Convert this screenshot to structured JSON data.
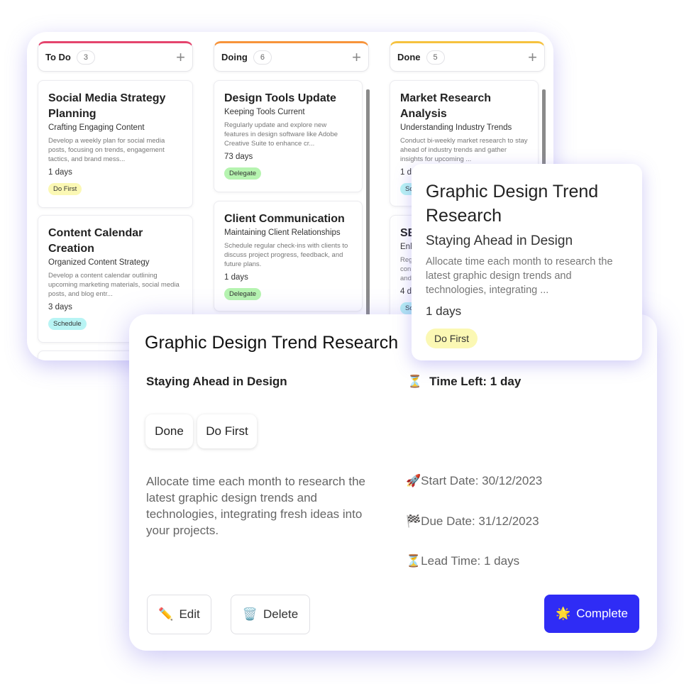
{
  "columns": [
    {
      "name": "To Do",
      "count": "3",
      "color": "#e5446d",
      "cards": [
        {
          "title": "Social Media Strategy Planning",
          "subtitle": "Crafting Engaging Content",
          "description": "Develop a weekly plan for social media posts, focusing on trends, engagement tactics, and brand mess...",
          "days": "1 days",
          "tag": "Do First",
          "tag_color": "#fbf8b4"
        },
        {
          "title": "Content Calendar Creation",
          "subtitle": "Organized Content Strategy",
          "description": "Develop a content calendar outlining upcoming marketing materials, social media posts, and blog entr...",
          "days": "3 days",
          "tag": "Schedule",
          "tag_color": "#b8f4f4"
        }
      ]
    },
    {
      "name": "Doing",
      "count": "6",
      "color": "#f7943b",
      "cards": [
        {
          "title": "Design Tools Update",
          "subtitle": "Keeping Tools Current",
          "description": "Regularly update and explore new features in design software like Adobe Creative Suite to enhance cr...",
          "days": "73 days",
          "tag": "Delegate",
          "tag_color": "#b6f4b0"
        },
        {
          "title": "Client Communication",
          "subtitle": "Maintaining Client Relationships",
          "description": "Schedule regular check-ins with clients to discuss project progress, feedback, and future plans.",
          "days": "1 days",
          "tag": "Delegate",
          "tag_color": "#b6f4b0"
        }
      ]
    },
    {
      "name": "Done",
      "count": "5",
      "color": "#f6c23e",
      "cards": [
        {
          "title": "Market Research Analysis",
          "subtitle": "Understanding Industry Trends",
          "description": "Conduct bi-weekly market research to stay ahead of industry trends and gather insights for upcoming ...",
          "days": "1 d",
          "tag": "Sc",
          "tag_color": "#b8f4f4"
        },
        {
          "title": "SE",
          "subtitle": "Enh",
          "description": "Reg con and",
          "days": "4 d",
          "tag": "Sc",
          "tag_color": "#b8f4f4"
        }
      ]
    }
  ],
  "hover_card": {
    "title": "Graphic Design Trend Research",
    "subtitle": "Staying Ahead in Design",
    "description": "Allocate time each month to research the latest graphic design trends and technologies, integrating ...",
    "days": "1 days",
    "tag": "Do First"
  },
  "modal": {
    "title": "Graphic Design Trend Research",
    "subtitle": "Staying Ahead in Design",
    "time_left": "Time Left: 1 day",
    "status": "Done",
    "priority": "Do First",
    "description": "Allocate time each month to research the latest graphic design trends and technologies, integrating fresh ideas into your projects.",
    "start_date": "Start Date: 30/12/2023",
    "due_date": "Due Date: 31/12/2023",
    "lead_time": "Lead Time: 1 days",
    "edit_label": "Edit",
    "delete_label": "Delete",
    "complete_label": "Complete",
    "accent": "#2f2cf5"
  }
}
